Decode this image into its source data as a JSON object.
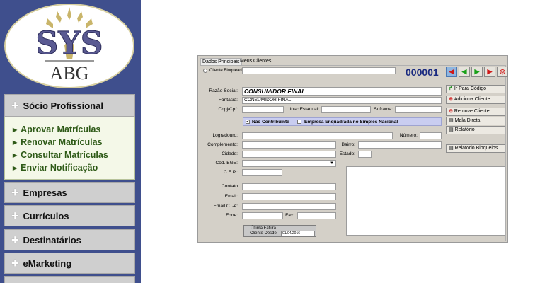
{
  "sidebar": {
    "logo": {
      "text_top": "SYS",
      "text_bottom": "ABG"
    },
    "socio": {
      "label": "Sócio Profissional",
      "items": [
        "Aprovar Matrículas",
        "Renovar Matrículas",
        "Consultar Matrículas",
        "Enviar Notificação"
      ]
    },
    "menus": [
      "Empresas",
      "Currículos",
      "Destinatários",
      "eMarketing"
    ]
  },
  "app": {
    "tabs": [
      "Dados Principais",
      "Meus Clientes"
    ],
    "cliente_bloqueado_label": "Cliente Bloqueado:",
    "record_number": "000001",
    "nav_buttons": [
      "first",
      "prev",
      "next",
      "last",
      "refresh"
    ],
    "side_buttons": [
      "Ir Para Código",
      "Adiciona Cliente",
      "Remove Cliente",
      "Mala Direta",
      "Relatório",
      "Relatório Bloqueios"
    ],
    "fields": {
      "razao_social": {
        "label": "Razão Social:",
        "value": "CONSUMIDOR FINAL"
      },
      "fantasia": {
        "label": "Fantasia:",
        "value": "CONSUMIDOR FINAL"
      },
      "cnpj_cpf": {
        "label": "Cnpj/Cpf:",
        "value": ""
      },
      "insc_estadual": {
        "label": "Insc.Estadual:",
        "value": ""
      },
      "suframa": {
        "label": "Suframa:",
        "value": ""
      },
      "logradouro": {
        "label": "Logradouro:",
        "value": ""
      },
      "numero": {
        "label": "Número:",
        "value": ""
      },
      "complemento": {
        "label": "Complemento:",
        "value": ""
      },
      "bairro": {
        "label": "Bairro:",
        "value": ""
      },
      "cidade": {
        "label": "Cidade:",
        "value": ""
      },
      "estado": {
        "label": "Estado:",
        "value": ""
      },
      "cod_ibge": {
        "label": "Cód.IBGE:",
        "value": ""
      },
      "cep": {
        "label": "C.E.P.:",
        "value": ""
      },
      "contato": {
        "label": "Contato",
        "value": ""
      },
      "email": {
        "label": "Email:",
        "value": ""
      },
      "email_cte": {
        "label": "Email CT-e:",
        "value": ""
      },
      "fone": {
        "label": "Fone:",
        "value": ""
      },
      "fax": {
        "label": "Fax:",
        "value": ""
      }
    },
    "checks": {
      "nao_contribuinte": {
        "label": "Não Contribuinte",
        "checked": true
      },
      "simples_nacional": {
        "label": "Empresa Enquadrada no Simples Nacional",
        "checked": false
      }
    },
    "ultima_fatura": {
      "line1": "Última Fatura",
      "line2": "Cliente Desde",
      "date": "01/04/2016"
    }
  }
}
